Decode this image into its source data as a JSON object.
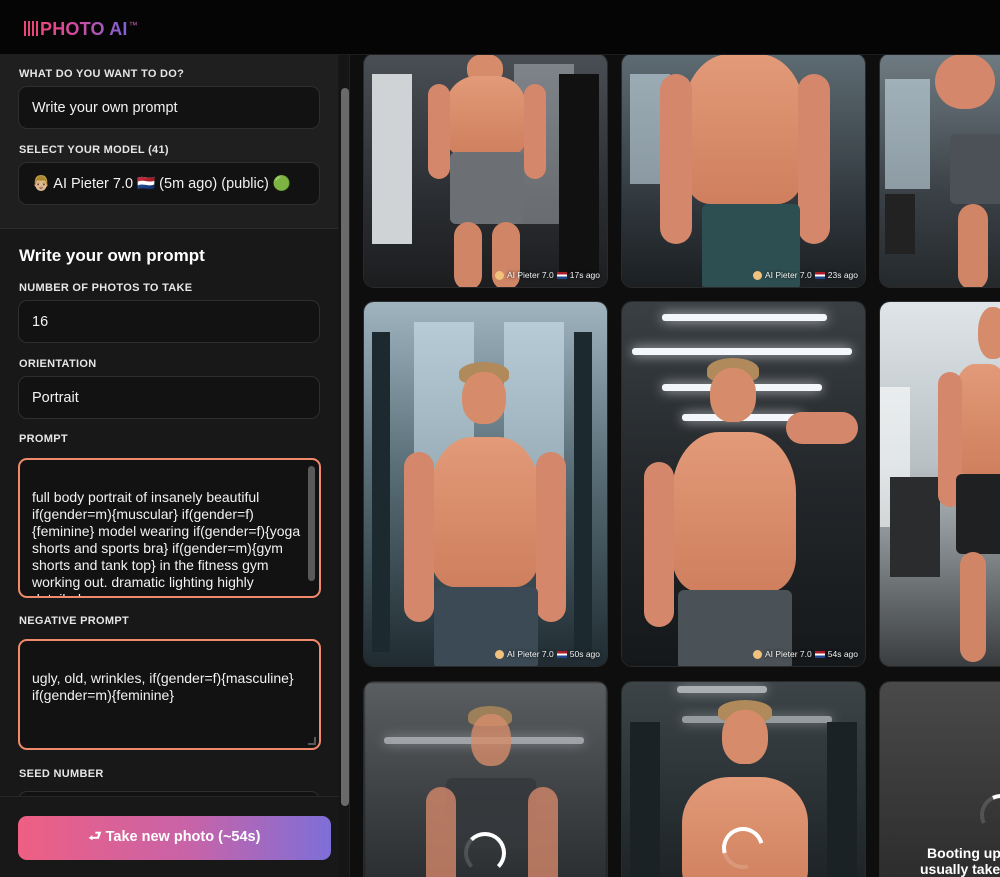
{
  "brand": {
    "name": "PHOTO AI",
    "tm": "™"
  },
  "form": {
    "action_label": "WHAT DO YOU WANT TO DO?",
    "action_value": "Write your own prompt",
    "model_label": "SELECT YOUR MODEL (41)",
    "model_value": "👨🏼 AI Pieter 7.0 🇳🇱 (5m ago) (public) 🟢",
    "section_title": "Write your own prompt",
    "photos_label": "NUMBER OF PHOTOS TO TAKE",
    "photos_value": "16",
    "orientation_label": "ORIENTATION",
    "orientation_value": "Portrait",
    "prompt_label": "PROMPT",
    "prompt_value": "full body portrait of insanely beautiful if(gender=m){muscular} if(gender=f){feminine} model wearing if(gender=f){yoga shorts and sports bra} if(gender=m){gym shorts and tank top} in the fitness gym working out. dramatic lighting highly detailed",
    "negative_label": "NEGATIVE PROMPT",
    "negative_value": "ugly, old, wrinkles, if(gender=f){masculine} if(gender=m){feminine}",
    "seed_label": "SEED NUMBER",
    "take_button": "⮐ Take new photo (~54s)"
  },
  "photos": [
    {
      "caption": "AI Pieter 7.0",
      "time": "17s ago"
    },
    {
      "caption": "AI Pieter 7.0",
      "time": "23s ago"
    },
    {
      "caption": "",
      "time": ""
    },
    {
      "caption": "AI Pieter 7.0",
      "time": "50s ago"
    },
    {
      "caption": "AI Pieter 7.0",
      "time": "54s ago"
    },
    {
      "caption": "",
      "time": ""
    },
    {
      "caption": "",
      "time": ""
    },
    {
      "caption": "",
      "time": ""
    },
    {
      "caption": "",
      "time": "",
      "boot_text": "Booting up\nusually takes"
    }
  ],
  "colors": {
    "accent_pink": "#ee5f83",
    "accent_purple": "#7d6fd8",
    "focus_border": "#f08a6a"
  }
}
